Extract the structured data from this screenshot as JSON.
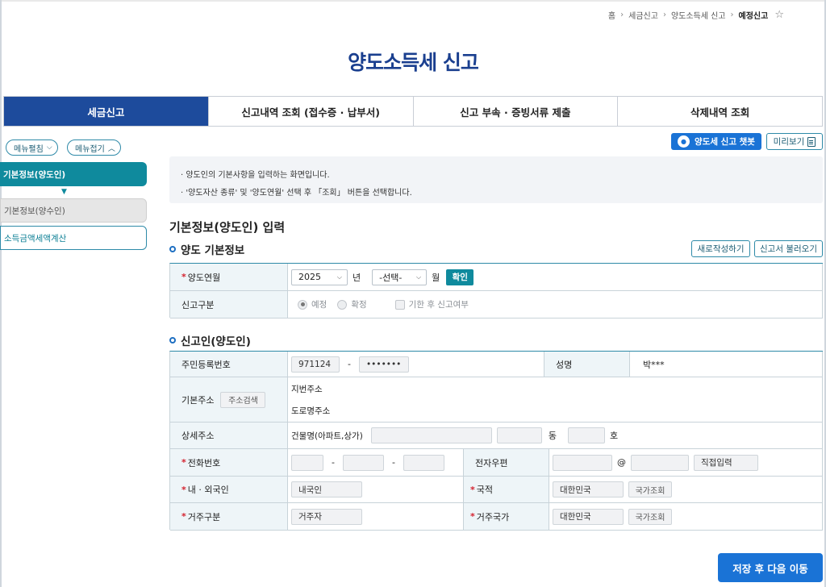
{
  "breadcrumb": {
    "items": [
      "홈",
      "세금신고",
      "양도소득세 신고"
    ],
    "current": "예정신고"
  },
  "page_title": "양도소득세 신고",
  "tabs": [
    {
      "label": "세금신고",
      "active": true
    },
    {
      "label": "신고내역 조회 (접수증 · 납부서)",
      "active": false
    },
    {
      "label": "신고 부속 · 증빙서류 제출",
      "active": false
    },
    {
      "label": "삭제내역 조회",
      "active": false
    }
  ],
  "left_menu": {
    "edit_label": "메뉴펼침",
    "collapse_label": "메뉴접기",
    "items": [
      {
        "label": "기본정보(양도인)",
        "state": "active"
      },
      {
        "label": "기본정보(양수인)",
        "state": "inactive"
      },
      {
        "label": "소득금액세액계산",
        "state": "link"
      }
    ]
  },
  "actions": {
    "chatbot_label": "양도세 신고 챗봇",
    "preview_label": "미리보기"
  },
  "notice": [
    "양도인의 기본사항을 입력하는 화면입니다.",
    "'양도자산 종류' 및 '양도연월' 선택 후 「조회」 버튼을 선택합니다."
  ],
  "section_title": "기본정보(양도인) 입력",
  "transfer_info": {
    "heading": "양도 기본정보",
    "new_button": "새로작성하기",
    "load_button": "신고서 불러오기",
    "month_label": "양도연월",
    "year_value": "2025",
    "year_unit": "년",
    "month_value": "-선택-",
    "month_unit": "월",
    "confirm_button": "확인",
    "type_label": "신고구분",
    "radio_scheduled": "예정",
    "radio_final": "확정",
    "late_checkbox": "기한 후 신고여부"
  },
  "reporter": {
    "heading": "신고인(양도인)",
    "rrn_label": "주민등록번호",
    "rrn_front": "971124",
    "rrn_dash": "-",
    "rrn_back": "•••••••",
    "name_label": "성명",
    "name_value": "박***",
    "address_label": "기본주소",
    "address_search_button": "주소검색",
    "lot_address_label": "지번주소",
    "road_address_label": "도로명주소",
    "detail_address_label": "상세주소",
    "building_label": "건물명(아파트,상가)",
    "dong_label": "동",
    "ho_label": "호",
    "phone_label": "전화번호",
    "phone_dash": "-",
    "email_label": "전자우편",
    "email_at": "@",
    "email_direct_button": "직접입력",
    "national_label": "내 · 외국인",
    "national_value": "내국인",
    "nationality_label": "국적",
    "nationality_value": "대한민국",
    "country_search_button": "국가조회",
    "residence_label": "거주구분",
    "residence_value": "거주자",
    "residence_country_label": "거주국가",
    "residence_country_value": "대한민국"
  },
  "save_button": "저장 후 다음 이동"
}
